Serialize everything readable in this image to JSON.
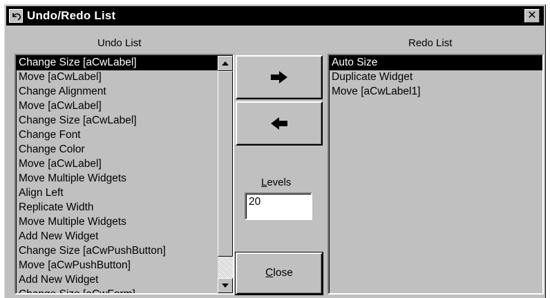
{
  "window": {
    "title": "Undo/Redo List"
  },
  "undo": {
    "label": "Undo List",
    "items": [
      "Change Size [aCwLabel]",
      "Move [aCwLabel]",
      "Change Alignment",
      "Move [aCwLabel]",
      "Change Size [aCwLabel]",
      "Change Font",
      "Change Color",
      "Move [aCwLabel]",
      "Move Multiple Widgets",
      "Align Left",
      "Replicate Width",
      "Move Multiple Widgets",
      "Add New Widget",
      "Change Size [aCwPushButton]",
      "Move [aCwPushButton]",
      "Add New Widget",
      "Change Size [aCwForm]"
    ],
    "selected_index": 0
  },
  "redo": {
    "label": "Redo List",
    "items": [
      "Auto Size",
      "Duplicate Widget",
      "Move [aCwLabel1]"
    ],
    "selected_index": 0
  },
  "controls": {
    "move_to_redo_icon": "arrow-right-icon",
    "move_to_undo_icon": "arrow-left-icon",
    "levels_label_mnemonic": "L",
    "levels_label_rest": "evels",
    "levels_value": "20",
    "close_mnemonic": "C",
    "close_rest": "lose"
  },
  "colors": {
    "face": "#c0c0c0",
    "selection": "#000000",
    "titlebar": "#000000"
  }
}
